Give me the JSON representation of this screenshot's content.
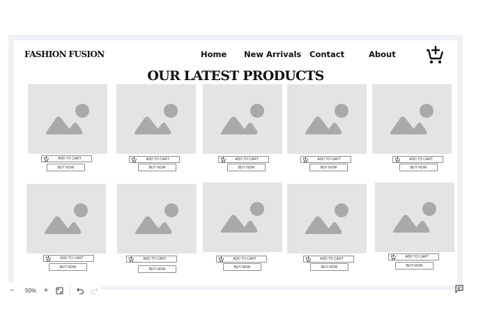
{
  "brand": "FASHION FUSION",
  "nav": [
    {
      "label": "Home",
      "name": "nav-home"
    },
    {
      "label": "New Arrivals",
      "name": "nav-new-arrivals"
    },
    {
      "label": "Contact",
      "name": "nav-contact"
    },
    {
      "label": "About",
      "name": "nav-about"
    }
  ],
  "cart_icon": "add-to-cart-icon",
  "title": "OUR LATEST PRODUCTS",
  "products": [
    {
      "add_label": "ADD TO CART",
      "buy_label": "BUY NOW"
    },
    {
      "add_label": "ADD TO CART",
      "buy_label": "BUY NOW"
    },
    {
      "add_label": "ADD TO CART",
      "buy_label": "BUY NOW"
    },
    {
      "add_label": "ADD TO CART",
      "buy_label": "BUY NOW"
    },
    {
      "add_label": "ADD TO CART",
      "buy_label": "BUY NOW"
    },
    {
      "add_label": "ADD TO CART",
      "buy_label": "BUY NOW"
    },
    {
      "add_label": "ADD TO CART",
      "buy_label": "BUY NOW"
    },
    {
      "add_label": "ADD TO CART",
      "buy_label": "BUY NOW"
    },
    {
      "add_label": "ADD TO CART",
      "buy_label": "BUY NOW"
    },
    {
      "add_label": "ADD TO CART",
      "buy_label": "BUY NOW"
    }
  ],
  "toolbar": {
    "zoom_out": "−",
    "zoom": "50%",
    "zoom_in": "+",
    "icons": [
      "fit-screen-icon",
      "undo-icon",
      "redo-icon"
    ]
  },
  "colors": {
    "placeholder": "#e4e4e4",
    "placeholder_shape": "#a9a9a9",
    "canvas": "#eef1f6"
  }
}
